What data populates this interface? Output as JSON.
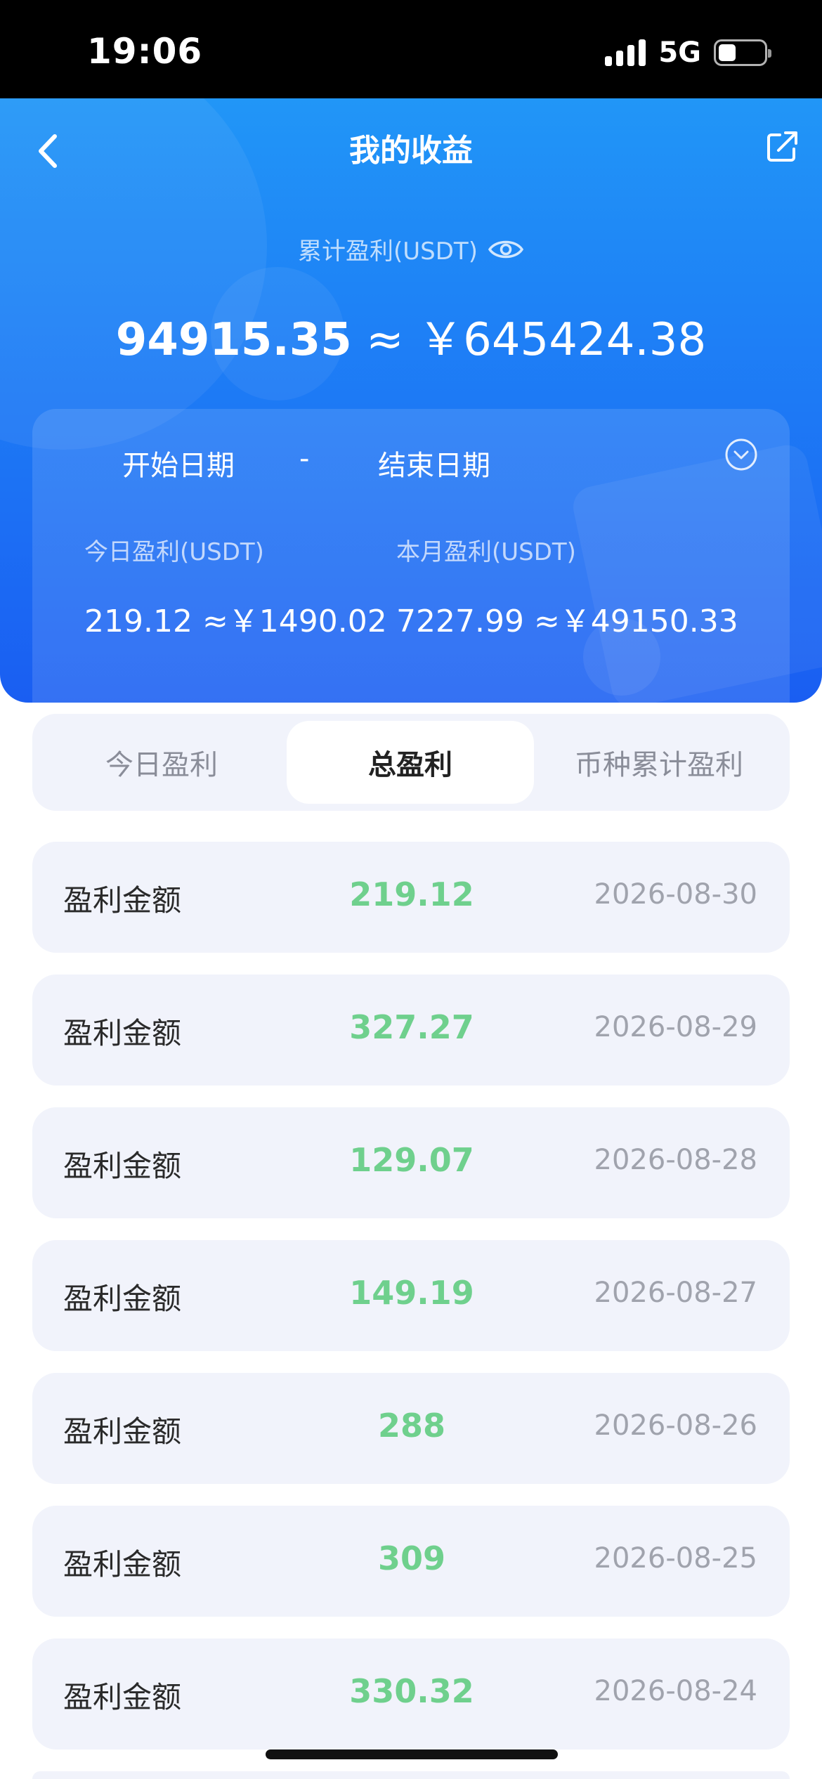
{
  "status_bar": {
    "time": "19:06",
    "network": "5G"
  },
  "header": {
    "title": "我的收益"
  },
  "summary": {
    "total_label": "累计盈利(USDT)",
    "total_usdt": "94915.35",
    "approx": "≈",
    "total_cny": "￥645424.38"
  },
  "date_filter": {
    "start": "开始日期",
    "separator": "-",
    "end": "结束日期"
  },
  "stats": {
    "today_label": "今日盈利(USDT)",
    "today_value": "219.12 ≈￥1490.02",
    "month_label": "本月盈利(USDT)",
    "month_value": "7227.99 ≈￥49150.33"
  },
  "tabs": [
    {
      "label": "今日盈利",
      "active": false
    },
    {
      "label": "总盈利",
      "active": true
    },
    {
      "label": "币种累计盈利",
      "active": false
    }
  ],
  "records": [
    {
      "label": "盈利金额",
      "amount": "219.12",
      "date": "2026-08-30"
    },
    {
      "label": "盈利金额",
      "amount": "327.27",
      "date": "2026-08-29"
    },
    {
      "label": "盈利金额",
      "amount": "129.07",
      "date": "2026-08-28"
    },
    {
      "label": "盈利金额",
      "amount": "149.19",
      "date": "2026-08-27"
    },
    {
      "label": "盈利金额",
      "amount": "288",
      "date": "2026-08-26"
    },
    {
      "label": "盈利金额",
      "amount": "309",
      "date": "2026-08-25"
    },
    {
      "label": "盈利金额",
      "amount": "330.32",
      "date": "2026-08-24"
    }
  ],
  "colors": {
    "hero_top": "#2196f7",
    "hero_bottom": "#1a5ef2",
    "amount_green": "#6fd08d",
    "row_background": "#f1f3fb"
  },
  "icons": {
    "back": "chevron-left-icon",
    "share": "share-icon",
    "visibility": "eye-icon",
    "date_dropdown": "chevron-down-circle-icon"
  }
}
